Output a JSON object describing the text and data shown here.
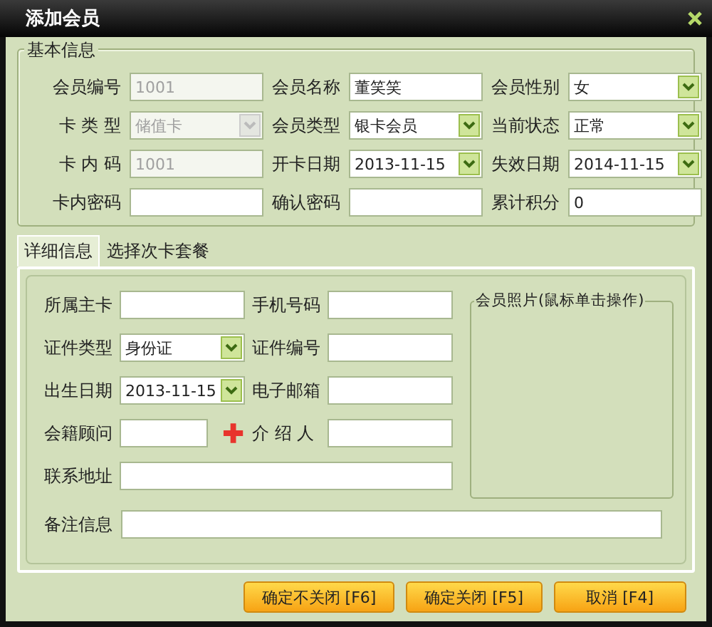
{
  "window": {
    "title": "添加会员"
  },
  "basic": {
    "title": "基本信息",
    "fields": [
      {
        "label": "会员编号",
        "kind": "text",
        "value": "1001",
        "disabled": true
      },
      {
        "label": "会员名称",
        "kind": "text",
        "value": "董笑笑",
        "disabled": false
      },
      {
        "label": "会员性别",
        "kind": "select",
        "value": "女",
        "disabled": false
      },
      {
        "label": "卡 类 型",
        "kind": "select",
        "value": "储值卡",
        "disabled": true
      },
      {
        "label": "会员类型",
        "kind": "select",
        "value": "银卡会员",
        "disabled": false
      },
      {
        "label": "当前状态",
        "kind": "select",
        "value": "正常",
        "disabled": false
      },
      {
        "label": "卡 内 码",
        "kind": "text",
        "value": "1001",
        "disabled": true
      },
      {
        "label": "开卡日期",
        "kind": "select",
        "value": "2013-11-15",
        "disabled": false
      },
      {
        "label": "失效日期",
        "kind": "select",
        "value": "2014-11-15",
        "disabled": false
      },
      {
        "label": "卡内密码",
        "kind": "text",
        "disabled": false
      },
      {
        "label": "确认密码",
        "kind": "text",
        "disabled": false
      },
      {
        "label": "累计积分",
        "kind": "text",
        "value": "0",
        "disabled": false
      }
    ]
  },
  "tabs": [
    {
      "label": "详细信息",
      "selected": true
    },
    {
      "label": "选择次卡套餐",
      "selected": false
    }
  ],
  "detail": {
    "rows": [
      [
        {
          "label": "所属主卡",
          "kind": "text"
        },
        {
          "label": "手机号码",
          "kind": "text"
        }
      ],
      [
        {
          "label": "证件类型",
          "kind": "select",
          "value": "身份证"
        },
        {
          "label": "证件编号",
          "kind": "text"
        }
      ],
      [
        {
          "label": "出生日期",
          "kind": "select",
          "value": "2013-11-15"
        },
        {
          "label": "电子邮箱",
          "kind": "text"
        }
      ],
      [
        {
          "label": "会籍顾问",
          "kind": "lookup"
        },
        {
          "label": "介 绍 人",
          "kind": "text"
        }
      ],
      [
        {
          "label": "联系地址",
          "kind": "wide"
        }
      ]
    ],
    "photo": {
      "title": "会员照片(鼠标单击操作)"
    },
    "remark": {
      "label": "备注信息",
      "kind": "wide"
    }
  },
  "buttons": [
    "确定不关闭 [F6]",
    "确定关闭 [F5]",
    "取消 [F4]"
  ]
}
